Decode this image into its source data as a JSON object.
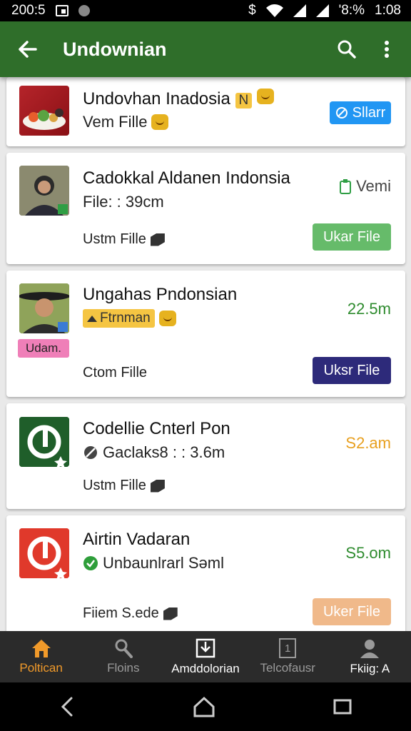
{
  "status_bar": {
    "time_left": "200:5",
    "right_text": "'8:%",
    "time": "1:08"
  },
  "app_bar": {
    "title": "Undownian"
  },
  "items": [
    {
      "title": "Undovhan Inadosia",
      "sub": "Vem Fille",
      "button": "Sllarr",
      "button_color": "#2196f3"
    },
    {
      "title": "Cadokkal Aldanen Indonsia",
      "sub": "File: : 39cm",
      "foot": "Ustm Fille",
      "right": "Vemi",
      "button": "Ukar File",
      "button_color": "#66bb6a"
    },
    {
      "title": "Ungahas Pndonsian",
      "pill": "Ftrnman",
      "badge": "Udam.",
      "foot": "Ctom Fille",
      "right": "22.5m",
      "right_color": "#2e8b2e",
      "button": "Uksr File",
      "button_color": "#2d2a7a"
    },
    {
      "title": "Codellie Cnterl Pon",
      "sub": "Gaclaks8 : : 3.6m",
      "foot": "Ustm Fille",
      "right": "S2.am",
      "right_color": "#e8a020"
    },
    {
      "title": "Airtin Vadaran",
      "sub": "Unbaunlrarl Səml",
      "foot": "Fiiem S.ede",
      "right": "S5.om",
      "right_color": "#2e8b2e",
      "button": "Uker File",
      "button_color": "#f0b98a"
    }
  ],
  "badge_letters": {
    "item1": "N"
  },
  "bottom_nav": [
    {
      "label": "Poltican",
      "icon": "home-icon"
    },
    {
      "label": "Floins",
      "icon": "search-icon"
    },
    {
      "label": "Amddolorian",
      "icon": "download-icon"
    },
    {
      "label": "Telcofausr",
      "icon": "one-icon"
    },
    {
      "label": "Fkiig: A",
      "icon": "person-icon"
    }
  ],
  "one_label": "1"
}
